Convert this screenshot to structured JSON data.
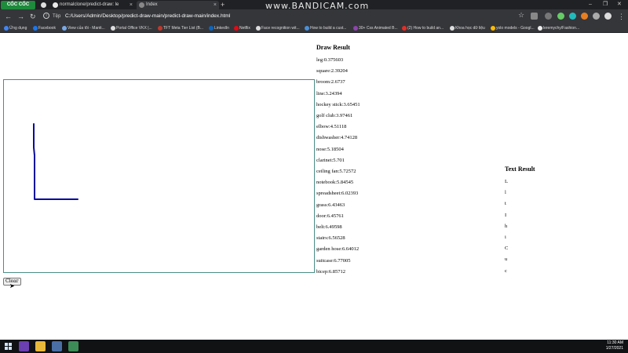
{
  "browser": {
    "brand": "CỐC CỐC",
    "tabs": [
      {
        "label": "normalclone/predict-draw: le"
      },
      {
        "label": "Index"
      }
    ],
    "new_tab": "+",
    "watermark": "www.BANDICAM.com",
    "window_controls": {
      "minimize": "–",
      "maximize": "❐",
      "close": "✕"
    },
    "protocol_label": "Tệp",
    "url": "C:/Users/Admin/Desktop/predict-draw-main/predict-draw-main/index.html",
    "bookmarks": [
      {
        "label": "Ứng dụng",
        "color": "#4285f4"
      },
      {
        "label": "Facebook",
        "color": "#1877f2"
      },
      {
        "label": "View của tôi - Manti...",
        "color": "#7aa9e6"
      },
      {
        "label": "Portal Office VKX |...",
        "color": "#dddddd"
      },
      {
        "label": "TFT Meta Tier List (B...",
        "color": "#c0392b"
      },
      {
        "label": "LinkedIn",
        "color": "#0a66c2"
      },
      {
        "label": "Netflix",
        "color": "#e50914"
      },
      {
        "label": "Face recognition wit...",
        "color": "#dddddd"
      },
      {
        "label": "How to build a cust...",
        "color": "#4a90d9"
      },
      {
        "label": "30+ Css Animated B...",
        "color": "#8e44ad"
      },
      {
        "label": "(2) How to build an...",
        "color": "#e52d27"
      },
      {
        "label": "Khoa học dữ liệu",
        "color": "#dddddd"
      },
      {
        "label": "yolo models - Googl...",
        "color": "#fbbc04"
      },
      {
        "label": "leremychy/Fashion...",
        "color": "#eeeeee"
      }
    ]
  },
  "page": {
    "draw_result_title": "Draw Result",
    "draw_results": [
      "leg:0.375603",
      "square:2.39204",
      "broom:2.6737",
      "line:3.24394",
      "hockey stick:3.65451",
      "golf club:3.97461",
      "elbow:4.51118",
      "dishwasher:4.74128",
      "nose:5.18504",
      "clarinet:5.701",
      "ceiling fan:5.72572",
      "notebook:5.84545",
      "spreadsheet:6.02393",
      "grass:6.43463",
      "door:6.45761",
      "belt:6.49598",
      "stairs:6.56528",
      "garden hose:6.64012",
      "suitcase:6.77005",
      "bicep:6.85712"
    ],
    "text_result_title": "Text Result",
    "text_results": [
      "L",
      "l",
      "t",
      "I",
      "h",
      "i",
      "C",
      "u",
      "c"
    ],
    "clear_label": "Clear",
    "stroke_color": "#0a0aa0"
  },
  "taskbar": {
    "time": "11:30 AM",
    "date": "1/27/2021"
  }
}
